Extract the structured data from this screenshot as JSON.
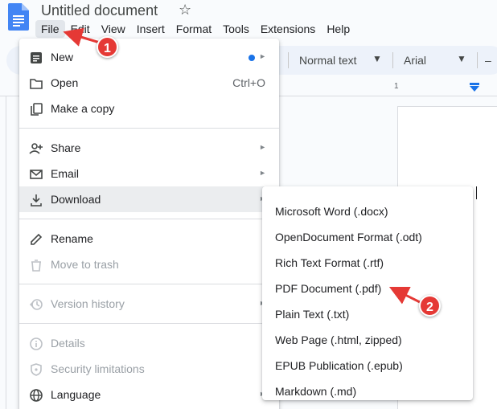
{
  "doc": {
    "title": "Untitled document"
  },
  "menubar": [
    "File",
    "Edit",
    "View",
    "Insert",
    "Format",
    "Tools",
    "Extensions",
    "Help"
  ],
  "toolbar": {
    "style": "Normal text",
    "font": "Arial",
    "minus": "–"
  },
  "ruler": {
    "number": "1"
  },
  "file_menu": {
    "new": "New",
    "open": "Open",
    "open_shortcut": "Ctrl+O",
    "make_copy": "Make a copy",
    "share": "Share",
    "email": "Email",
    "download": "Download",
    "rename": "Rename",
    "move_to_trash": "Move to trash",
    "version_history": "Version history",
    "details": "Details",
    "security_limitations": "Security limitations",
    "language": "Language",
    "submenu_arrow": "►"
  },
  "download_menu": [
    "Microsoft Word (.docx)",
    "OpenDocument Format (.odt)",
    "Rich Text Format (.rtf)",
    "PDF Document (.pdf)",
    "Plain Text (.txt)",
    "Web Page (.html, zipped)",
    "EPUB Publication (.epub)",
    "Markdown (.md)"
  ],
  "annotations": {
    "step1": "1",
    "step2": "2"
  },
  "colors": {
    "accent": "#1a73e8",
    "badge": "#e53935",
    "highlight": "#ebedef"
  }
}
